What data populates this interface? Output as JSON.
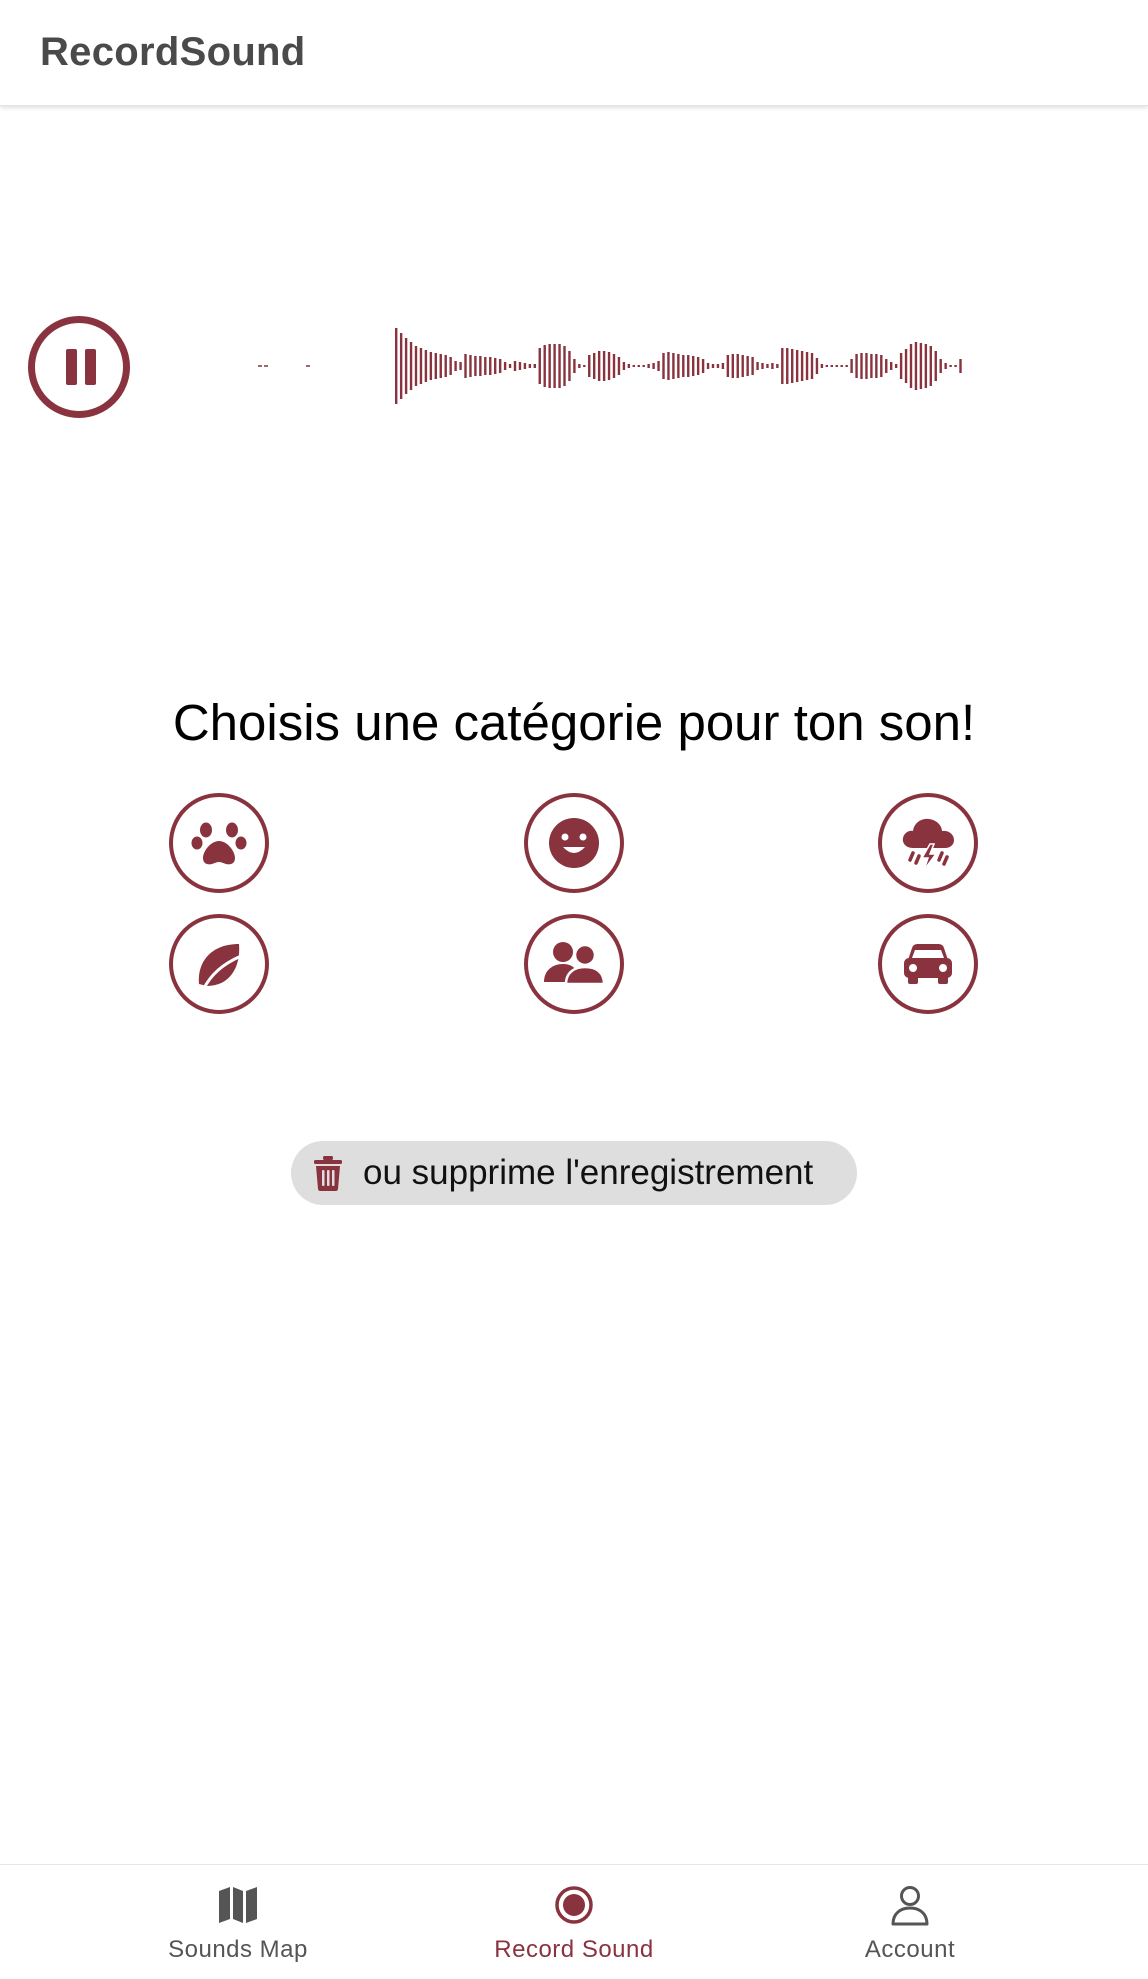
{
  "app": {
    "title": "RecordSound"
  },
  "colors": {
    "accent": "#89333f",
    "nav_inactive": "#555555",
    "pill_background": "#dedede"
  },
  "player": {
    "state": "recording-playback",
    "pause_icon": "pause-icon"
  },
  "category": {
    "heading": "Choisis une catégorie pour ton son!",
    "options": [
      {
        "id": "animals",
        "icon": "paw-icon"
      },
      {
        "id": "people-voice",
        "icon": "smile-icon"
      },
      {
        "id": "weather",
        "icon": "thunderstorm-icon"
      },
      {
        "id": "nature",
        "icon": "leaf-icon"
      },
      {
        "id": "crowd",
        "icon": "users-icon"
      },
      {
        "id": "traffic",
        "icon": "car-icon"
      }
    ]
  },
  "delete": {
    "label": "ou supprime l'enregistrement",
    "icon": "trash-icon"
  },
  "nav": {
    "items": [
      {
        "label": "Sounds Map",
        "icon": "map-icon",
        "active": false
      },
      {
        "label": "Record Sound",
        "icon": "record-icon",
        "active": true
      },
      {
        "label": "Account",
        "icon": "person-icon",
        "active": false
      }
    ]
  }
}
